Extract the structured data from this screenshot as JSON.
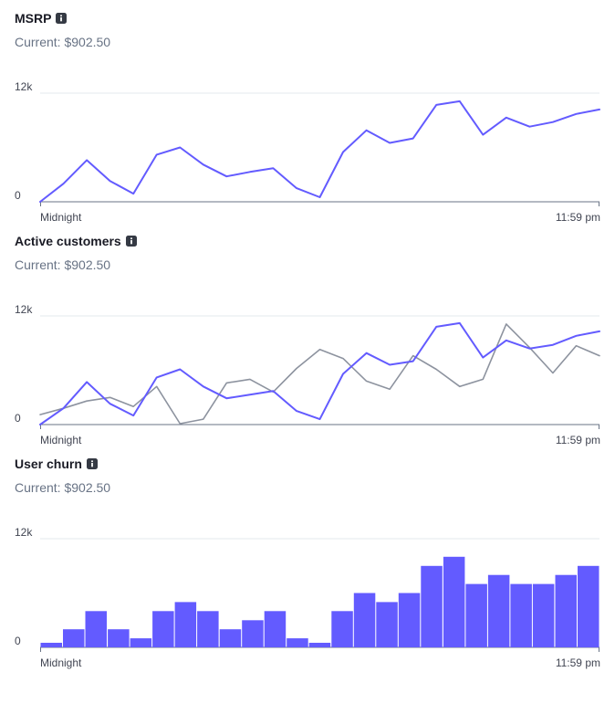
{
  "colors": {
    "primary": "#635bff",
    "secondary": "#8d939f",
    "grid": "#e3e8ee",
    "axis": "#687385"
  },
  "icons": {
    "info": "info-icon"
  },
  "chart_data": [
    {
      "type": "line",
      "title": "MSRP",
      "subtitle": "Current: $902.50",
      "x_start_label": "Midnight",
      "x_end_label": "11:59 pm",
      "ylim": [
        0,
        12000
      ],
      "yticks": [
        "0",
        "12k"
      ],
      "series": [
        {
          "values": [
            0,
            2000,
            4600,
            2300,
            900,
            5200,
            6000,
            4100,
            2800,
            3300,
            3700,
            1500,
            500,
            5500,
            7900,
            6500,
            7000,
            10700,
            11100,
            7400,
            9300,
            8300,
            8800,
            9700,
            10200
          ]
        }
      ]
    },
    {
      "type": "line",
      "title": "Active customers",
      "subtitle": "Current: $902.50",
      "x_start_label": "Midnight",
      "x_end_label": "11:59 pm",
      "ylim": [
        0,
        12000
      ],
      "yticks": [
        "0",
        "12k"
      ],
      "series": [
        {
          "values": [
            0,
            1800,
            4700,
            2300,
            1000,
            5200,
            6100,
            4200,
            2900,
            3300,
            3700,
            1500,
            600,
            5600,
            7900,
            6600,
            7000,
            10800,
            11200,
            7400,
            9300,
            8400,
            8800,
            9800,
            10300
          ]
        },
        {
          "values": [
            1100,
            1800,
            2600,
            3000,
            2000,
            4200,
            100,
            600,
            4600,
            5000,
            3600,
            6200,
            8300,
            7300,
            4800,
            3900,
            7600,
            6100,
            4200,
            5000,
            11100,
            8500,
            5700,
            8700,
            7600
          ]
        }
      ]
    },
    {
      "type": "bar",
      "title": "User churn",
      "subtitle": "Current: $902.50",
      "x_start_label": "Midnight",
      "x_end_label": "11:59 pm",
      "ylim": [
        0,
        12000
      ],
      "yticks": [
        "0",
        "12k"
      ],
      "series": [
        {
          "values": [
            500,
            2000,
            4000,
            2000,
            1000,
            4000,
            5000,
            4000,
            2000,
            3000,
            4000,
            1000,
            500,
            4000,
            6000,
            5000,
            6000,
            9000,
            10000,
            7000,
            8000,
            7000,
            7000,
            8000,
            9000
          ]
        }
      ]
    }
  ]
}
